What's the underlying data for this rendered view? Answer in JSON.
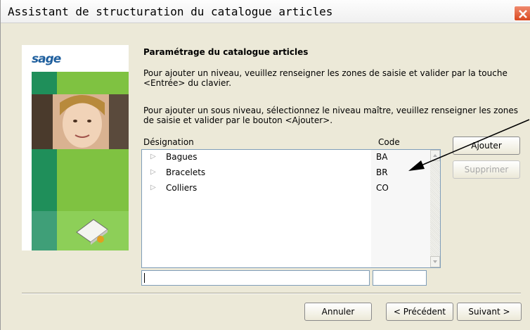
{
  "window": {
    "title": "Assistant de structuration du catalogue articles"
  },
  "sidebar": {
    "logo_text": "sage"
  },
  "content": {
    "title": "Paramétrage du catalogue articles",
    "paragraph_1": "Pour ajouter un niveau, veuillez renseigner les zones de saisie et valider par la touche <Entrée> du clavier.",
    "paragraph_2": "Pour ajouter un sous niveau, sélectionnez le niveau maître, veuillez renseigner les zones de saisie et valider par le bouton <Ajouter>."
  },
  "list": {
    "column_designation": "Désignation",
    "column_code": "Code",
    "rows": [
      {
        "designation": "Bagues",
        "code": "BA"
      },
      {
        "designation": "Bracelets",
        "code": "BR"
      },
      {
        "designation": "Colliers",
        "code": "CO"
      }
    ]
  },
  "inputs": {
    "designation_value": "",
    "code_value": ""
  },
  "buttons": {
    "ajouter": "Ajouter",
    "supprimer": "Supprimer",
    "annuler": "Annuler",
    "precedent": "< Précédent",
    "suivant": "Suivant >"
  },
  "colors": {
    "sidebar_green": "#1f8f5a",
    "sidebar_light_green": "#7fc241",
    "close_button": "#d9481f"
  }
}
